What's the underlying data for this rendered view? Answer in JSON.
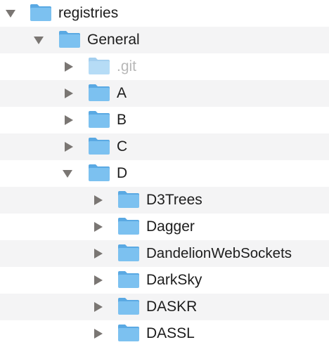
{
  "tree": {
    "root": {
      "name": "registries",
      "expanded": true,
      "icon": "folder-icon"
    },
    "general": {
      "name": "General",
      "expanded": true,
      "icon": "folder-icon"
    },
    "items": [
      {
        "name": ".git",
        "expanded": false,
        "hidden": true,
        "icon": "folder-icon"
      },
      {
        "name": "A",
        "expanded": false,
        "icon": "folder-icon"
      },
      {
        "name": "B",
        "expanded": false,
        "icon": "folder-icon"
      },
      {
        "name": "C",
        "expanded": false,
        "icon": "folder-icon"
      },
      {
        "name": "D",
        "expanded": true,
        "icon": "folder-icon"
      }
    ],
    "d_children": [
      {
        "name": "D3Trees",
        "expanded": false,
        "icon": "folder-icon"
      },
      {
        "name": "Dagger",
        "expanded": false,
        "icon": "folder-icon"
      },
      {
        "name": "DandelionWebSockets",
        "expanded": false,
        "icon": "folder-icon"
      },
      {
        "name": "DarkSky",
        "expanded": false,
        "icon": "folder-icon"
      },
      {
        "name": "DASKR",
        "expanded": false,
        "icon": "folder-icon"
      },
      {
        "name": "DASSL",
        "expanded": false,
        "icon": "folder-icon"
      }
    ]
  },
  "colors": {
    "folder_body": "#7cc1f0",
    "folder_tab": "#5aa9e3",
    "arrow": "#7a7673",
    "row_alt": "#f4f4f5",
    "text": "#1d1d1d",
    "text_hidden": "#b8b8b8"
  }
}
